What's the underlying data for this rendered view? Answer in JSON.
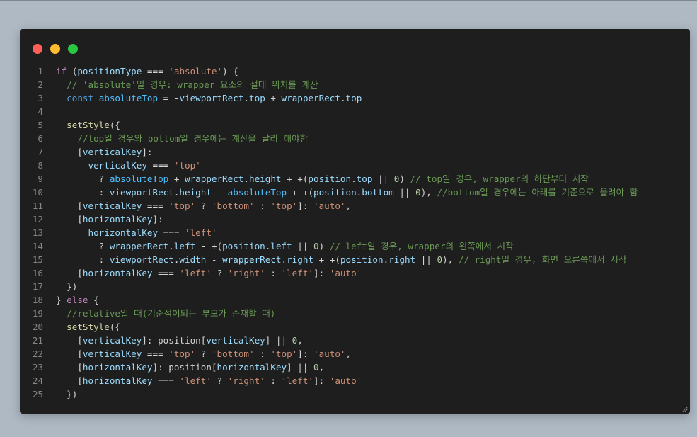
{
  "window_controls": [
    "close",
    "minimize",
    "maximize"
  ],
  "code_lines": [
    {
      "n": "1",
      "t": [
        [
          "ck",
          "if"
        ],
        [
          "p",
          " ("
        ],
        [
          "v",
          "positionType"
        ],
        [
          "p",
          " === "
        ],
        [
          "s",
          "'absolute'"
        ],
        [
          "p",
          ") {"
        ]
      ]
    },
    {
      "n": "2",
      "t": [
        [
          "p",
          "  "
        ],
        [
          "cm",
          "// 'absolute'일 경우: wrapper 요소의 절대 위치를 계산"
        ]
      ]
    },
    {
      "n": "3",
      "t": [
        [
          "p",
          "  "
        ],
        [
          "k",
          "const"
        ],
        [
          "p",
          " "
        ],
        [
          "c",
          "absoluteTop"
        ],
        [
          "p",
          " = -"
        ],
        [
          "v",
          "viewportRect"
        ],
        [
          "p",
          "."
        ],
        [
          "v",
          "top"
        ],
        [
          "p",
          " + "
        ],
        [
          "v",
          "wrapperRect"
        ],
        [
          "p",
          "."
        ],
        [
          "v",
          "top"
        ]
      ]
    },
    {
      "n": "4",
      "t": []
    },
    {
      "n": "5",
      "t": [
        [
          "p",
          "  "
        ],
        [
          "f",
          "setStyle"
        ],
        [
          "p",
          "({"
        ]
      ]
    },
    {
      "n": "6",
      "t": [
        [
          "p",
          "    "
        ],
        [
          "cm",
          "//top일 경우와 bottom일 경우에는 계산을 달리 해야함"
        ]
      ]
    },
    {
      "n": "7",
      "t": [
        [
          "p",
          "    ["
        ],
        [
          "v",
          "verticalKey"
        ],
        [
          "p",
          "]:"
        ]
      ]
    },
    {
      "n": "8",
      "t": [
        [
          "p",
          "      "
        ],
        [
          "v",
          "verticalKey"
        ],
        [
          "p",
          " === "
        ],
        [
          "s",
          "'top'"
        ]
      ]
    },
    {
      "n": "9",
      "t": [
        [
          "p",
          "        ? "
        ],
        [
          "c",
          "absoluteTop"
        ],
        [
          "p",
          " + "
        ],
        [
          "v",
          "wrapperRect"
        ],
        [
          "p",
          "."
        ],
        [
          "v",
          "height"
        ],
        [
          "p",
          " + +("
        ],
        [
          "v",
          "position"
        ],
        [
          "p",
          "."
        ],
        [
          "v",
          "top"
        ],
        [
          "p",
          " || "
        ],
        [
          "n",
          "0"
        ],
        [
          "p",
          ") "
        ],
        [
          "cm",
          "// top일 경우, wrapper의 하단부터 시작"
        ]
      ]
    },
    {
      "n": "10",
      "t": [
        [
          "p",
          "        : "
        ],
        [
          "v",
          "viewportRect"
        ],
        [
          "p",
          "."
        ],
        [
          "v",
          "height"
        ],
        [
          "p",
          " - "
        ],
        [
          "c",
          "absoluteTop"
        ],
        [
          "p",
          " + +("
        ],
        [
          "v",
          "position"
        ],
        [
          "p",
          "."
        ],
        [
          "v",
          "bottom"
        ],
        [
          "p",
          " || "
        ],
        [
          "n",
          "0"
        ],
        [
          "p",
          "), "
        ],
        [
          "cm",
          "//bottom일 경우에는 아래를 기준으로 올려야 함"
        ]
      ]
    },
    {
      "n": "11",
      "t": [
        [
          "p",
          "    ["
        ],
        [
          "v",
          "verticalKey"
        ],
        [
          "p",
          " === "
        ],
        [
          "s",
          "'top'"
        ],
        [
          "p",
          " ? "
        ],
        [
          "s",
          "'bottom'"
        ],
        [
          "p",
          " : "
        ],
        [
          "s",
          "'top'"
        ],
        [
          "p",
          "]: "
        ],
        [
          "s",
          "'auto'"
        ],
        [
          "p",
          ","
        ]
      ]
    },
    {
      "n": "12",
      "t": [
        [
          "p",
          "    ["
        ],
        [
          "v",
          "horizontalKey"
        ],
        [
          "p",
          "]:"
        ]
      ]
    },
    {
      "n": "13",
      "t": [
        [
          "p",
          "      "
        ],
        [
          "v",
          "horizontalKey"
        ],
        [
          "p",
          " === "
        ],
        [
          "s",
          "'left'"
        ]
      ]
    },
    {
      "n": "14",
      "t": [
        [
          "p",
          "        ? "
        ],
        [
          "v",
          "wrapperRect"
        ],
        [
          "p",
          "."
        ],
        [
          "v",
          "left"
        ],
        [
          "p",
          " - +("
        ],
        [
          "v",
          "position"
        ],
        [
          "p",
          "."
        ],
        [
          "v",
          "left"
        ],
        [
          "p",
          " || "
        ],
        [
          "n",
          "0"
        ],
        [
          "p",
          ") "
        ],
        [
          "cm",
          "// left일 경우, wrapper의 왼쪽에서 시작"
        ]
      ]
    },
    {
      "n": "15",
      "t": [
        [
          "p",
          "        : "
        ],
        [
          "v",
          "viewportRect"
        ],
        [
          "p",
          "."
        ],
        [
          "v",
          "width"
        ],
        [
          "p",
          " - "
        ],
        [
          "v",
          "wrapperRect"
        ],
        [
          "p",
          "."
        ],
        [
          "v",
          "right"
        ],
        [
          "p",
          " + +("
        ],
        [
          "v",
          "position"
        ],
        [
          "p",
          "."
        ],
        [
          "v",
          "right"
        ],
        [
          "p",
          " || "
        ],
        [
          "n",
          "0"
        ],
        [
          "p",
          "), "
        ],
        [
          "cm",
          "// right일 경우, 화면 오른쪽에서 시작"
        ]
      ]
    },
    {
      "n": "16",
      "t": [
        [
          "p",
          "    ["
        ],
        [
          "v",
          "horizontalKey"
        ],
        [
          "p",
          " === "
        ],
        [
          "s",
          "'left'"
        ],
        [
          "p",
          " ? "
        ],
        [
          "s",
          "'right'"
        ],
        [
          "p",
          " : "
        ],
        [
          "s",
          "'left'"
        ],
        [
          "p",
          "]: "
        ],
        [
          "s",
          "'auto'"
        ]
      ]
    },
    {
      "n": "17",
      "t": [
        [
          "p",
          "  })"
        ]
      ]
    },
    {
      "n": "18",
      "t": [
        [
          "p",
          "} "
        ],
        [
          "ck",
          "else"
        ],
        [
          "p",
          " {"
        ]
      ]
    },
    {
      "n": "19",
      "t": [
        [
          "p",
          "  "
        ],
        [
          "cm",
          "//relative일 때(기준점이되는 부모가 존재할 때)"
        ]
      ]
    },
    {
      "n": "20",
      "t": [
        [
          "p",
          "  "
        ],
        [
          "f",
          "setStyle"
        ],
        [
          "p",
          "({"
        ]
      ]
    },
    {
      "n": "21",
      "t": [
        [
          "p",
          "    ["
        ],
        [
          "v",
          "verticalKey"
        ],
        [
          "p",
          "]: position["
        ],
        [
          "v",
          "verticalKey"
        ],
        [
          "p",
          "] || "
        ],
        [
          "n",
          "0"
        ],
        [
          "p",
          ","
        ]
      ]
    },
    {
      "n": "22",
      "t": [
        [
          "p",
          "    ["
        ],
        [
          "v",
          "verticalKey"
        ],
        [
          "p",
          " === "
        ],
        [
          "s",
          "'top'"
        ],
        [
          "p",
          " ? "
        ],
        [
          "s",
          "'bottom'"
        ],
        [
          "p",
          " : "
        ],
        [
          "s",
          "'top'"
        ],
        [
          "p",
          "]: "
        ],
        [
          "s",
          "'auto'"
        ],
        [
          "p",
          ","
        ]
      ]
    },
    {
      "n": "23",
      "t": [
        [
          "p",
          "    ["
        ],
        [
          "v",
          "horizontalKey"
        ],
        [
          "p",
          "]: position["
        ],
        [
          "v",
          "horizontalKey"
        ],
        [
          "p",
          "] || "
        ],
        [
          "n",
          "0"
        ],
        [
          "p",
          ","
        ]
      ]
    },
    {
      "n": "24",
      "t": [
        [
          "p",
          "    ["
        ],
        [
          "v",
          "horizontalKey"
        ],
        [
          "p",
          " === "
        ],
        [
          "s",
          "'left'"
        ],
        [
          "p",
          " ? "
        ],
        [
          "s",
          "'right'"
        ],
        [
          "p",
          " : "
        ],
        [
          "s",
          "'left'"
        ],
        [
          "p",
          "]: "
        ],
        [
          "s",
          "'auto'"
        ]
      ]
    },
    {
      "n": "25",
      "t": [
        [
          "p",
          "  })"
        ]
      ]
    }
  ]
}
